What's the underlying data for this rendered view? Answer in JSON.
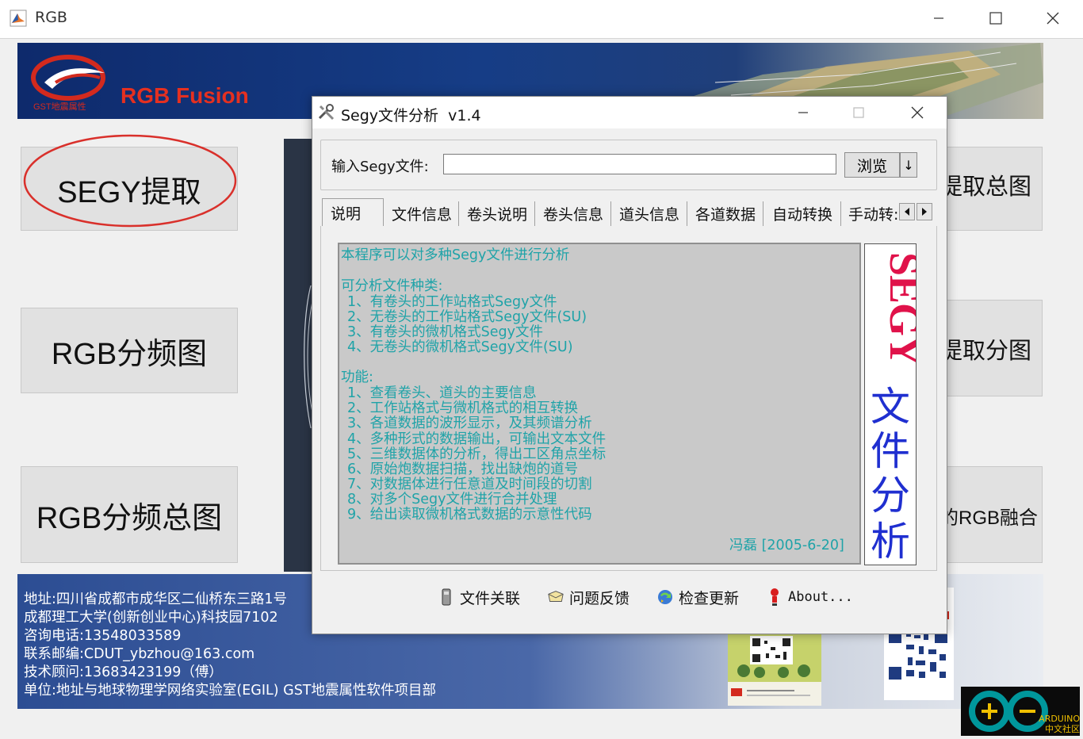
{
  "main_window": {
    "title": "RGB",
    "brand_title": "RGB Fusion",
    "brand_logo_text": "GST地震属性",
    "left_buttons": [
      "SEGY提取",
      "RGB分频图",
      "RGB分频总图"
    ],
    "right_buttons": [
      "提取总图",
      "提取分图",
      "的RGB融合"
    ],
    "footer_lines": [
      "地址:四川省成都市成华区二仙桥东三路1号",
      "成都理工大学(创新创业中心)科技园7102",
      "咨询电话:13548033589",
      "联系邮编:CDUT_ybzhou@163.com",
      "技术顾问:13683423199（傅）",
      "单位:地址与地球物理学网络实验室(EGIL) GST地震属性软件项目部"
    ],
    "watermark_text": "ARDUINO 中文社区"
  },
  "dialog": {
    "title": "Segy文件分析  v1.4",
    "input_label": "输入Segy文件:",
    "input_value": "",
    "browse_label": "浏览",
    "arrow_label": "↓",
    "tabs": [
      "说明",
      "文件信息",
      "卷头说明",
      "卷头信息",
      "道头信息",
      "各道数据",
      "自动转换",
      "手动转:"
    ],
    "active_tab": "说明",
    "description": {
      "intro": "本程序可以对多种Segy文件进行分析",
      "types_heading": "可分析文件种类:",
      "types": [
        "1、有卷头的工作站格式Segy文件",
        "2、无卷头的工作站格式Segy文件(SU)",
        "3、有卷头的微机格式Segy文件",
        "4、无卷头的微机格式Segy文件(SU)"
      ],
      "features_heading": "功能:",
      "features": [
        "1、查看卷头、道头的主要信息",
        "2、工作站格式与微机格式的相互转换",
        "3、各道数据的波形显示，及其频谱分析",
        "4、多种形式的数据输出，可输出文本文件",
        "5、三维数据体的分析，得出工区角点坐标",
        "6、原始炮数据扫描，找出缺炮的道号",
        "7、对数据体进行任意道及时间段的切割",
        "8、对多个Segy文件进行合并处理",
        "9、给出读取微机格式数据的示意性代码"
      ],
      "signature": "冯磊 [2005-6-20]"
    },
    "logo_vertical_text": "SEGY文件分析",
    "actions": [
      {
        "label": "文件关联",
        "icon": "file-association-icon"
      },
      {
        "label": "问题反馈",
        "icon": "feedback-icon"
      },
      {
        "label": "检查更新",
        "icon": "update-icon"
      },
      {
        "label": "About...",
        "icon": "about-icon"
      }
    ]
  }
}
